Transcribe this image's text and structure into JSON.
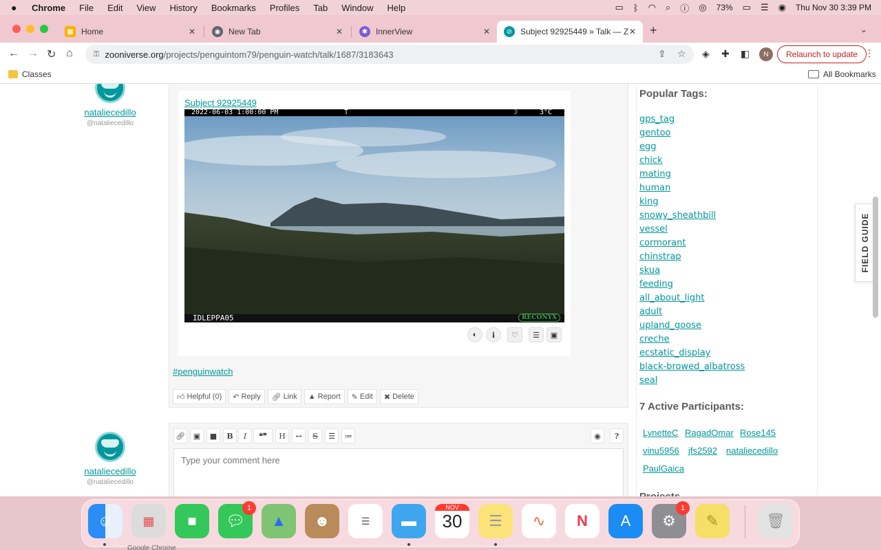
{
  "menubar": {
    "app": "Chrome",
    "items": [
      "File",
      "Edit",
      "View",
      "History",
      "Bookmarks",
      "Profiles",
      "Tab",
      "Window",
      "Help"
    ],
    "battery": "73%",
    "datetime": "Thu Nov 30  3:39 PM"
  },
  "tabs": [
    {
      "title": "Home",
      "icon": "google-classroom-icon"
    },
    {
      "title": "New Tab",
      "icon": "chrome-icon"
    },
    {
      "title": "InnerView",
      "icon": "innerview-icon"
    },
    {
      "title": "Subject 92925449 » Talk — Z",
      "icon": "zooniverse-icon",
      "active": true
    }
  ],
  "toolbar": {
    "url_domain": "zooniverse.org",
    "url_path": "/projects/penguintom79/penguin-watch/talk/1687/3183643",
    "profile_initial": "N",
    "relaunch_label": "Relaunch to update"
  },
  "bookmarks": {
    "left": "Classes",
    "right": "All Bookmarks"
  },
  "post": {
    "author": "nataliecedillo",
    "handle": "@nataliecedillo",
    "subject_link": "Subject 92925449",
    "photo_timestamp": "2022-06-03 1:00:00 PM",
    "photo_flag": "T",
    "photo_moon": "☽",
    "photo_temp": "3°C",
    "camera_id": "IDLEPPA05",
    "camera_brand": "RECONYX",
    "hashtag": "#penguinwatch",
    "actions": {
      "helpful": "Helpful (0)",
      "reply": "Reply",
      "link": "Link",
      "report": "Report",
      "edit": "Edit",
      "delete": "Delete"
    }
  },
  "composer": {
    "author": "nataliecedillo",
    "handle": "@nataliecedillo",
    "placeholder": "Type your comment here"
  },
  "sidebar": {
    "popular_tags_title": "Popular Tags:",
    "tags": [
      "gps_tag",
      "gentoo",
      "egg",
      "chick",
      "mating",
      "human",
      "king",
      "snowy_sheathbill",
      "vessel",
      "cormorant",
      "chinstrap",
      "skua",
      "feeding",
      "all_about_light",
      "adult",
      "upland_goose",
      "creche",
      "ecstatic_display",
      "black-browed_albatross",
      "seal"
    ],
    "participants_title": "7 Active Participants:",
    "participants": [
      "LynetteC",
      "RagadOmar",
      "Rose145",
      "vinu5956",
      "jfs2592",
      "nataliecedillo",
      "PaulGaica"
    ],
    "next_heading_partial": "Projects"
  },
  "field_guide_label": "FIELD GUIDE",
  "dock": {
    "messages_badge": "1",
    "settings_badge": "1",
    "calendar_month": "NOV",
    "calendar_day": "30",
    "tooltip_partial": "Google Chrome"
  }
}
